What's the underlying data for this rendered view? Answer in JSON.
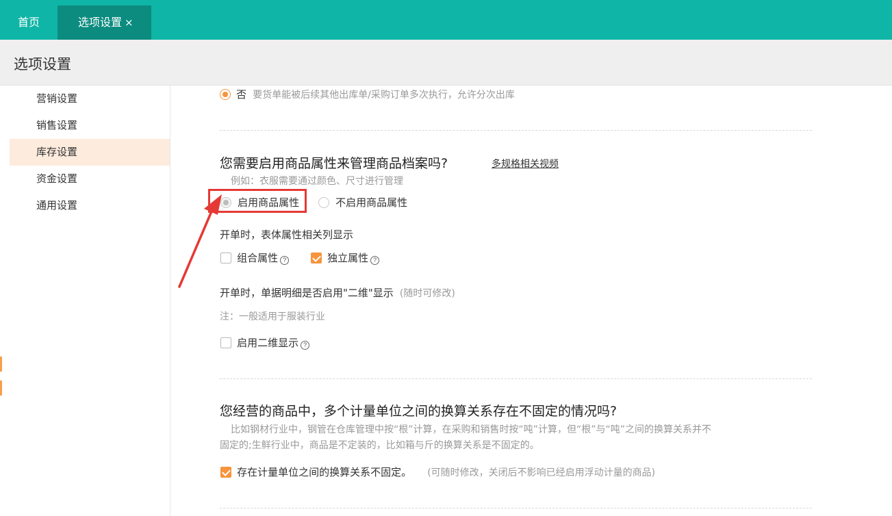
{
  "tabs": {
    "home": "首页",
    "active": "选项设置",
    "close_glyph": "×"
  },
  "page_title": "选项设置",
  "sidebar": {
    "items": [
      {
        "label": "营销设置"
      },
      {
        "label": "销售设置"
      },
      {
        "label": "库存设置"
      },
      {
        "label": "资金设置"
      },
      {
        "label": "通用设置"
      }
    ]
  },
  "section_prev": {
    "option_label": "否",
    "option_desc": "要货单能被后续其他出库单/采购订单多次执行，允许分次出库"
  },
  "section_attr": {
    "question": "您需要启用商品属性来管理商品档案吗?",
    "video_link": "多规格相关视频",
    "example": "例如：衣服需要通过颜色、尺寸进行管理",
    "opt_enable": "启用商品属性",
    "opt_disable": "不启用商品属性",
    "columns_title": "开单时，表体属性相关列显示",
    "combo_attr": "组合属性",
    "independent_attr": "独立属性",
    "twod_title": "开单时，单据明细是否启用\"二维\"显示",
    "twod_note": "(随时可修改)",
    "twod_hint": "注：一般适用于服装行业",
    "twod_checkbox": "启用二维显示"
  },
  "section_units": {
    "question": "您经营的商品中，多个计量单位之间的换算关系存在不固定的情况吗?",
    "desc_line1": "比如钢材行业中，钢管在仓库管理中按“根”计算，在采购和销售时按“吨”计算，但“根”与“吨”之间的换算关系并不",
    "desc_line2": "固定的;生鲜行业中，商品是不定装的，比如箱与斤的换算关系是不固定的。",
    "checkbox_label": "存在计量单位之间的换算关系不固定。",
    "checkbox_note": "(可随时修改，关闭后不影响已经启用浮动计量的商品)"
  },
  "help_glyph": "?",
  "colors": {
    "topbar": "#0fb5a6",
    "active_tab": "#0b8c7f",
    "accent_orange": "#f7943c",
    "annotation_red": "#e53935",
    "sidebar_active": "#fdebdd"
  },
  "state": {
    "prev_option_selected": true,
    "attr_option": "enable",
    "combo_attr_checked": false,
    "independent_attr_checked": true,
    "twod_checked": false,
    "units_checked": true
  }
}
